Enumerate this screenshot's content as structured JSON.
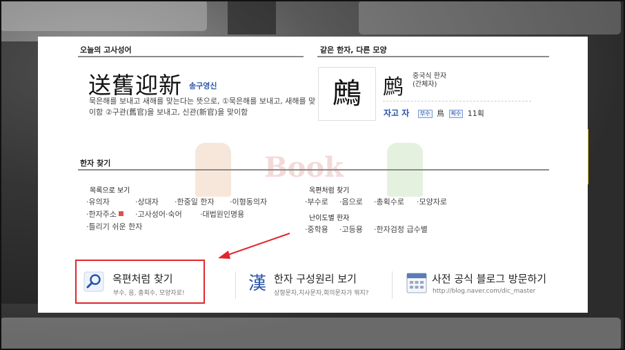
{
  "today_idiom": {
    "section_title": "오늘의 고사성어",
    "hanja": "送舊迎新",
    "reading": "송구영신",
    "description": "묵은해를 보내고 새해를 맞는다는 뜻으로, ①묵은해를 보내고, 새해를 맞이함 ②구관(舊官)을 보내고, 신관(新官)을 맞이함"
  },
  "same_char": {
    "section_title": "같은 한자, 다른 모양",
    "char": "鷓",
    "variant_char": "鹧",
    "type_line1": "중국식 한자",
    "type_line2": "(간체자)",
    "reading": "자고 자",
    "radical_badge": "부수",
    "radical": "鳥",
    "stroke_badge": "획수",
    "strokes": "11획"
  },
  "search": {
    "section_title": "한자 찾기",
    "list_view": {
      "title": "목록으로 보기",
      "row1": [
        "유의자",
        "상대자",
        "한중일 한자",
        "이형동의자"
      ],
      "row2": [
        "한자주소",
        "고사성어·숙어",
        "대법원인명용"
      ],
      "row3": [
        "틀리기 쉬운 한자"
      ]
    },
    "okpyeon": {
      "title": "옥편처럼 찾기",
      "items": [
        "부수로",
        "음으로",
        "총획수로",
        "모양자로"
      ]
    },
    "level": {
      "title": "난이도별 한자",
      "items": [
        "중학용",
        "고등용",
        "한자검정 급수별"
      ]
    }
  },
  "bottom": {
    "item1": {
      "title": "옥편처럼 찾기",
      "sub": "부수, 음, 총획수, 모양자로!"
    },
    "item2": {
      "icon_char": "漢",
      "title": "한자 구성원리 보기",
      "sub": "상형문자,지사문자,회의문자가 뭐지?"
    },
    "item3": {
      "title": "사전 공식 블로그 방문하기",
      "sub": "http://blog.naver.com/dic_master"
    }
  },
  "watermark_text": "Book",
  "colors": {
    "accent_blue": "#2a55a8",
    "highlight_red": "#e0262c"
  }
}
